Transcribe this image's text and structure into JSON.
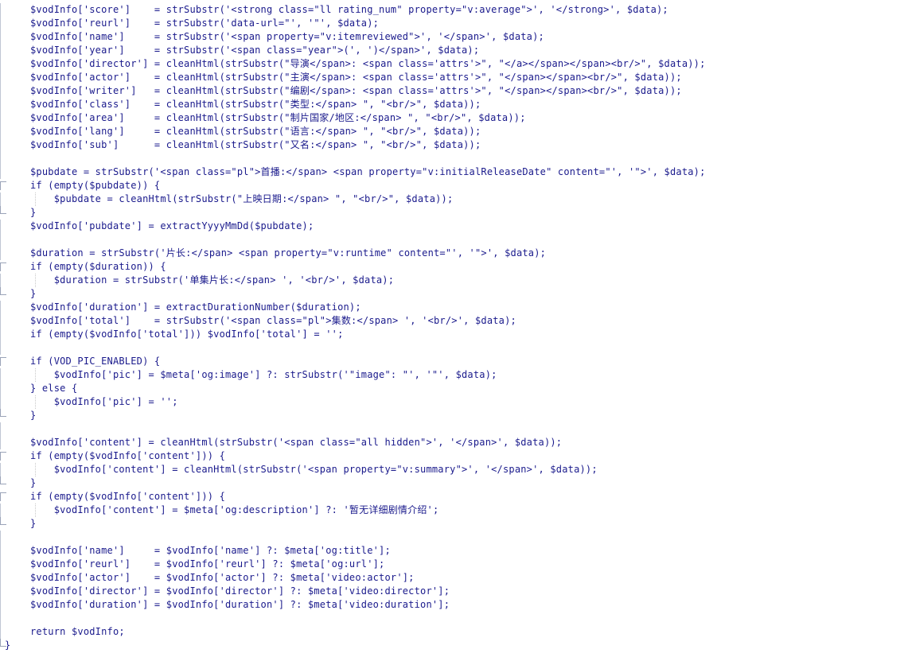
{
  "editor": {
    "lines": [
      {
        "fold": "mid",
        "text": "$vodInfo['score']    = strSubstr('<strong class=\"ll rating_num\" property=\"v:average\">', '</strong>', $data);"
      },
      {
        "fold": "mid",
        "text": "$vodInfo['reurl']    = strSubstr('data-url=\"', '\"', $data);"
      },
      {
        "fold": "mid",
        "text": "$vodInfo['name']     = strSubstr('<span property=\"v:itemreviewed\">', '</span>', $data);"
      },
      {
        "fold": "mid",
        "text": "$vodInfo['year']     = strSubstr('<span class=\"year\">(', ')</span>', $data);"
      },
      {
        "fold": "mid",
        "text": "$vodInfo['director'] = cleanHtml(strSubstr(\"导演</span>: <span class='attrs'>\", \"</a></span></span><br/>\", $data));"
      },
      {
        "fold": "mid",
        "text": "$vodInfo['actor']    = cleanHtml(strSubstr(\"主演</span>: <span class='attrs'>\", \"</span></span><br/>\", $data));"
      },
      {
        "fold": "mid",
        "text": "$vodInfo['writer']   = cleanHtml(strSubstr(\"编剧</span>: <span class='attrs'>\", \"</span></span><br/>\", $data));"
      },
      {
        "fold": "mid",
        "text": "$vodInfo['class']    = cleanHtml(strSubstr(\"类型:</span> \", \"<br/>\", $data));"
      },
      {
        "fold": "mid",
        "text": "$vodInfo['area']     = cleanHtml(strSubstr(\"制片国家/地区:</span> \", \"<br/>\", $data));"
      },
      {
        "fold": "mid",
        "text": "$vodInfo['lang']     = cleanHtml(strSubstr(\"语言:</span> \", \"<br/>\", $data));"
      },
      {
        "fold": "mid",
        "text": "$vodInfo['sub']      = cleanHtml(strSubstr(\"又名:</span> \", \"<br/>\", $data));"
      },
      {
        "fold": "mid",
        "text": ""
      },
      {
        "fold": "mid",
        "text": "$pubdate = strSubstr('<span class=\"pl\">首播:</span> <span property=\"v:initialReleaseDate\" content=\"', '\">', $data);"
      },
      {
        "fold": "open",
        "text": "if (empty($pubdate)) {"
      },
      {
        "fold": "mid",
        "text": "    $pubdate = cleanHtml(strSubstr(\"上映日期:</span> \", \"<br/>\", $data));"
      },
      {
        "fold": "close",
        "text": "}"
      },
      {
        "fold": "mid",
        "text": "$vodInfo['pubdate'] = extractYyyyMmDd($pubdate);"
      },
      {
        "fold": "mid",
        "text": ""
      },
      {
        "fold": "mid",
        "text": "$duration = strSubstr('片长:</span> <span property=\"v:runtime\" content=\"', '\">', $data);"
      },
      {
        "fold": "open",
        "text": "if (empty($duration)) {"
      },
      {
        "fold": "mid",
        "text": "    $duration = strSubstr('单集片长:</span> ', '<br/>', $data);"
      },
      {
        "fold": "close",
        "text": "}"
      },
      {
        "fold": "mid",
        "text": "$vodInfo['duration'] = extractDurationNumber($duration);"
      },
      {
        "fold": "mid",
        "text": "$vodInfo['total']    = strSubstr('<span class=\"pl\">集数:</span> ', '<br/>', $data);"
      },
      {
        "fold": "mid",
        "text": "if (empty($vodInfo['total'])) $vodInfo['total'] = '';"
      },
      {
        "fold": "mid",
        "text": ""
      },
      {
        "fold": "open",
        "text": "if (VOD_PIC_ENABLED) {"
      },
      {
        "fold": "mid",
        "text": "    $vodInfo['pic'] = $meta['og:image'] ?: strSubstr('\"image\": \"', '\"', $data);"
      },
      {
        "fold": "mid",
        "text": "} else {"
      },
      {
        "fold": "mid",
        "text": "    $vodInfo['pic'] = '';"
      },
      {
        "fold": "close",
        "text": "}"
      },
      {
        "fold": "mid",
        "text": ""
      },
      {
        "fold": "mid",
        "text": "$vodInfo['content'] = cleanHtml(strSubstr('<span class=\"all hidden\">', '</span>', $data));"
      },
      {
        "fold": "open",
        "text": "if (empty($vodInfo['content'])) {"
      },
      {
        "fold": "mid",
        "text": "    $vodInfo['content'] = cleanHtml(strSubstr('<span property=\"v:summary\">', '</span>', $data));"
      },
      {
        "fold": "close",
        "text": "}"
      },
      {
        "fold": "open",
        "text": "if (empty($vodInfo['content'])) {"
      },
      {
        "fold": "mid",
        "text": "    $vodInfo['content'] = $meta['og:description'] ?: '暂无详细剧情介绍';"
      },
      {
        "fold": "close",
        "text": "}"
      },
      {
        "fold": "mid",
        "text": ""
      },
      {
        "fold": "mid",
        "text": "$vodInfo['name']     = $vodInfo['name'] ?: $meta['og:title'];"
      },
      {
        "fold": "mid",
        "text": "$vodInfo['reurl']    = $vodInfo['reurl'] ?: $meta['og:url'];"
      },
      {
        "fold": "mid",
        "text": "$vodInfo['actor']    = $vodInfo['actor'] ?: $meta['video:actor'];"
      },
      {
        "fold": "mid",
        "text": "$vodInfo['director'] = $vodInfo['director'] ?: $meta['video:director'];"
      },
      {
        "fold": "mid",
        "text": "$vodInfo['duration'] = $vodInfo['duration'] ?: $meta['video:duration'];"
      },
      {
        "fold": "mid",
        "text": ""
      },
      {
        "fold": "mid",
        "text": "return $vodInfo;"
      },
      {
        "fold": "end",
        "text": "}"
      }
    ]
  }
}
